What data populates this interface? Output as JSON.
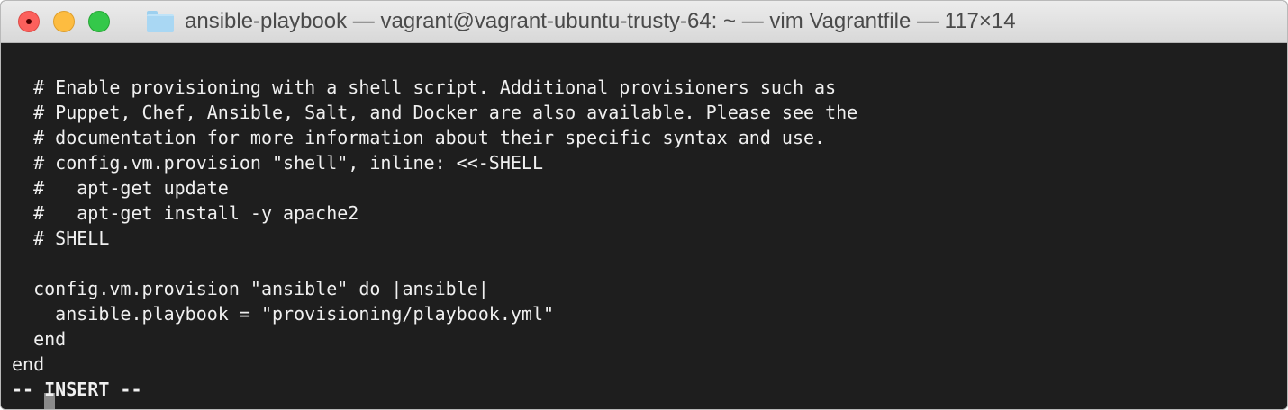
{
  "window": {
    "title": "ansible-playbook — vagrant@vagrant-ubuntu-trusty-64: ~ — vim Vagrantfile — 117×14",
    "controls": {
      "close": "close",
      "minimize": "minimize",
      "zoom": "zoom"
    },
    "icon": "folder-icon"
  },
  "editor": {
    "lines": [
      "",
      "  # Enable provisioning with a shell script. Additional provisioners such as",
      "  # Puppet, Chef, Ansible, Salt, and Docker are also available. Please see the",
      "  # documentation for more information about their specific syntax and use.",
      "  # config.vm.provision \"shell\", inline: <<-SHELL",
      "  #   apt-get update",
      "  #   apt-get install -y apache2",
      "  # SHELL",
      "",
      "  config.vm.provision \"ansible\" do |ansible|",
      "    ansible.playbook = \"provisioning/playbook.yml\"",
      "  end",
      "end"
    ],
    "mode": "-- INSERT --"
  },
  "colors": {
    "background": "#1e1e1e",
    "text": "#f0f0f0",
    "cursor": "#8a8a8a"
  }
}
